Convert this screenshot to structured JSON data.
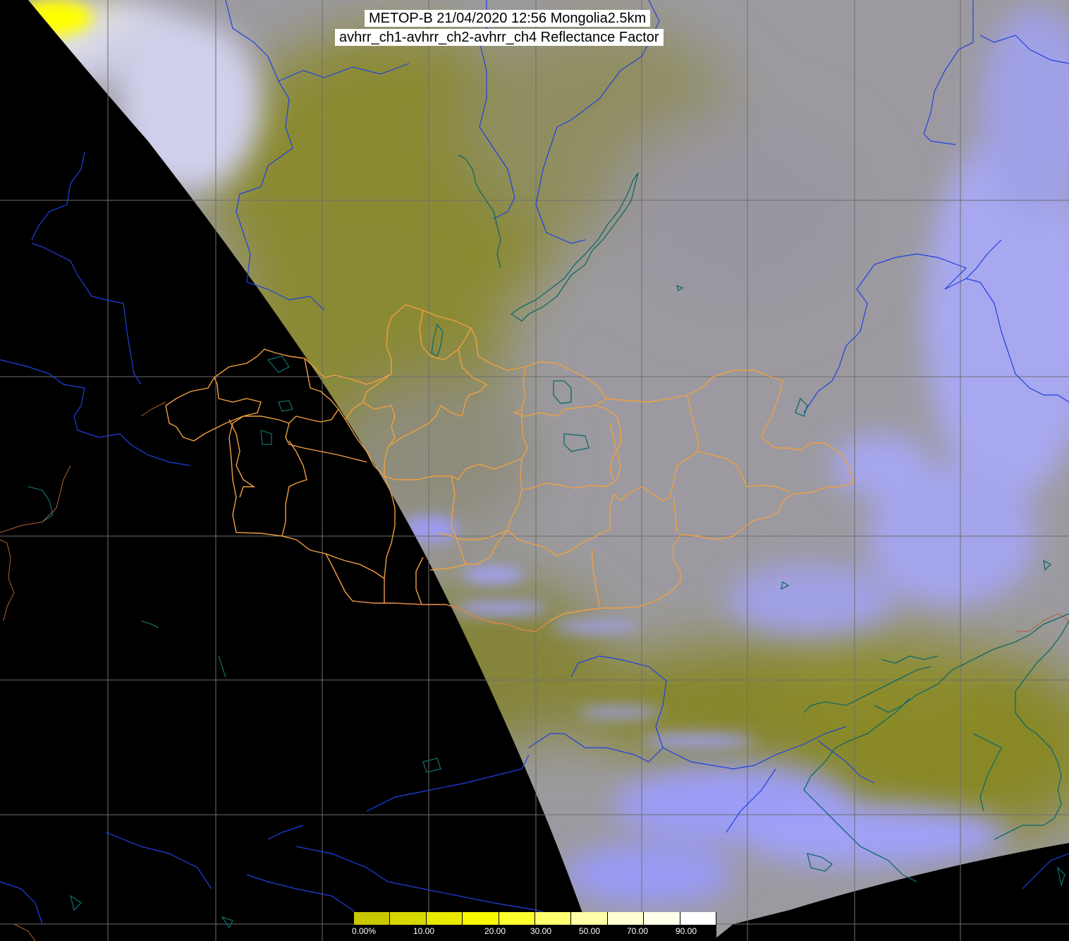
{
  "header": {
    "title_line1": "METOP-B 21/04/2020 12:56 Mongolia2.5km",
    "title_line2": "avhrr_ch1-avhrr_ch2-avhrr_ch4 Reflectance Factor"
  },
  "colorbar": {
    "labels": [
      "0.00%",
      "10.00",
      "20.00",
      "30.00",
      "50.00",
      "70.00",
      "90.00"
    ],
    "segment_colors": [
      "#c8c800",
      "#d8d800",
      "#e8e800",
      "#f8f800",
      "#ffff30",
      "#ffff70",
      "#ffffa8",
      "#ffffd0",
      "#ffffe8",
      "#ffffff"
    ]
  },
  "colors": {
    "night": "#000000",
    "land_olive": "#8a8a3a",
    "cloud_lavender": "#9a9ae6",
    "gray_haze": "#9c9aa0",
    "bright_cloud": "#ffff40",
    "grid": "#6e6e6e",
    "rivers": "#2040e0",
    "coast_lakes": "#106868",
    "country_border": "#c06a3a",
    "province_border": "#f0a040"
  },
  "grid": {
    "visible": true
  }
}
